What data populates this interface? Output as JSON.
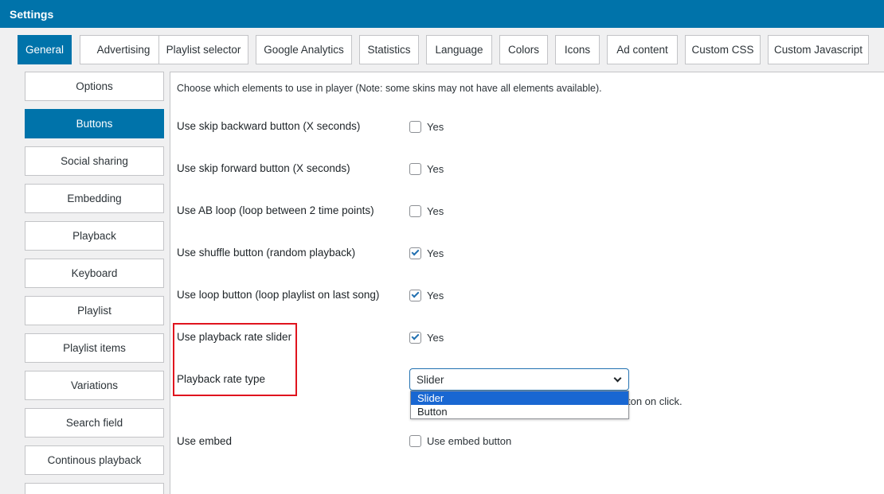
{
  "header": {
    "title": "Settings"
  },
  "tabs": [
    {
      "label": "General",
      "active": true
    },
    {
      "label": "Advertising",
      "active": false
    },
    {
      "label": "Playlist selector",
      "active": false
    },
    {
      "label": "Google Analytics",
      "active": false
    },
    {
      "label": "Statistics",
      "active": false
    },
    {
      "label": "Language",
      "active": false
    },
    {
      "label": "Colors",
      "active": false
    },
    {
      "label": "Icons",
      "active": false
    },
    {
      "label": "Ad content",
      "active": false
    },
    {
      "label": "Custom CSS",
      "active": false
    },
    {
      "label": "Custom Javascript",
      "active": false
    }
  ],
  "sidebar": {
    "items": [
      {
        "label": "Options",
        "active": false
      },
      {
        "label": "Buttons",
        "active": true
      },
      {
        "label": "Social sharing",
        "active": false
      },
      {
        "label": "Embedding",
        "active": false
      },
      {
        "label": "Playback",
        "active": false
      },
      {
        "label": "Keyboard",
        "active": false
      },
      {
        "label": "Playlist",
        "active": false
      },
      {
        "label": "Playlist items",
        "active": false
      },
      {
        "label": "Variations",
        "active": false
      },
      {
        "label": "Search field",
        "active": false
      },
      {
        "label": "Continous playback",
        "active": false
      }
    ]
  },
  "main": {
    "intro": "Choose which elements to use in player (Note: some skins may not have all elements available).",
    "rows": [
      {
        "label": "Use skip backward button (X seconds)",
        "checked": false,
        "option_label": "Yes"
      },
      {
        "label": "Use skip forward button (X seconds)",
        "checked": false,
        "option_label": "Yes"
      },
      {
        "label": "Use AB loop (loop between 2 time points)",
        "checked": false,
        "option_label": "Yes"
      },
      {
        "label": "Use shuffle button (random playback)",
        "checked": true,
        "option_label": "Yes"
      },
      {
        "label": "Use loop button (loop playlist on last song)",
        "checked": true,
        "option_label": "Yes"
      },
      {
        "label": "Use playback rate slider",
        "checked": true,
        "option_label": "Yes"
      }
    ],
    "playback_rate_type": {
      "label": "Playback rate type",
      "value": "Slider",
      "options": [
        "Slider",
        "Button"
      ],
      "selected_option": "Slider",
      "help_text": "ton on click."
    },
    "embed": {
      "label": "Use embed",
      "checked": false,
      "option_label": "Use embed button"
    }
  },
  "colors": {
    "accent": "#0073aa",
    "highlight_border": "#e0141e",
    "dropdown_selected": "#1967d2"
  }
}
